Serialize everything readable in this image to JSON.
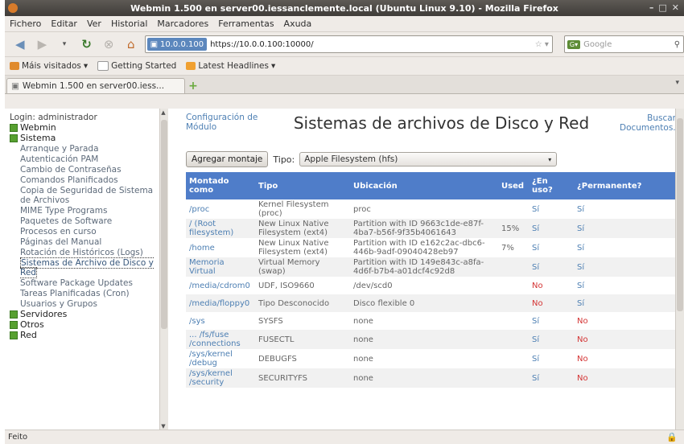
{
  "window": {
    "title": "Webmin 1.500 en server00.iessanclemente.local (Ubuntu Linux 9.10) - Mozilla Firefox"
  },
  "menubar": [
    "Fichero",
    "Editar",
    "Ver",
    "Historial",
    "Marcadores",
    "Ferramentas",
    "Axuda"
  ],
  "nav": {
    "identity": "10.0.0.100",
    "url": "https://10.0.0.100:10000/",
    "search_placeholder": "Google"
  },
  "bookmarks": [
    "Máis visitados",
    "Getting Started",
    "Latest Headlines"
  ],
  "tab": {
    "title": "Webmin 1.500 en server00.iess..."
  },
  "sidebar": {
    "login": "Login: administrador",
    "categories": [
      {
        "label": "Webmin"
      },
      {
        "label": "Sistema"
      },
      {
        "label": "Servidores"
      },
      {
        "label": "Otros"
      },
      {
        "label": "Red"
      }
    ],
    "items": [
      "Arranque y Parada",
      "Autenticación PAM",
      "Cambio de Contraseñas",
      "Comandos Planificados",
      "Copia de Seguridad de Sistema de Archivos",
      "MIME Type Programs",
      "Paquetes de Software",
      "Procesos en curso",
      "Páginas del Manual",
      "Rotación de Históricos (Logs)",
      "Sistemas de Archivo de Disco y Red",
      "Software Package Updates",
      "Tareas Planificadas (Cron)",
      "Usuarios y Grupos"
    ]
  },
  "main": {
    "config_link": "Configuración de Módulo",
    "title": "Sistemas de archivos de Disco y Red",
    "search_link": "Buscar Documentos..",
    "add_button": "Agregar montaje",
    "type_label": "Tipo:",
    "type_value": "Apple Filesystem (hfs)",
    "columns": [
      "Montado como",
      "Tipo",
      "Ubicación",
      "Used",
      "¿En uso?",
      "¿Permanente?"
    ],
    "rows": [
      {
        "mount": "/proc",
        "type": "Kernel Filesystem (proc)",
        "location": "proc",
        "used": "",
        "inuse": "Sí",
        "perm": "Sí"
      },
      {
        "mount": "/ (Root filesystem)",
        "type": "New Linux Native Filesystem (ext4)",
        "location": "Partition with ID 9663c1de-e87f-4ba7-b56f-9f35b4061643",
        "used": "15%",
        "inuse": "Sí",
        "perm": "Sí"
      },
      {
        "mount": "/home",
        "type": "New Linux Native Filesystem (ext4)",
        "location": "Partition with ID e162c2ac-dbc6-446b-9adf-09040428eb97",
        "used": "7%",
        "inuse": "Sí",
        "perm": "Sí"
      },
      {
        "mount": "Memoria Virtual",
        "type": "Virtual Memory (swap)",
        "location": "Partition with ID 149e843c-a8fa-4d6f-b7b4-a01dcf4c92d8",
        "used": "",
        "inuse": "Sí",
        "perm": "Sí"
      },
      {
        "mount": "/media/cdrom0",
        "type": "UDF, ISO9660",
        "location": "/dev/scd0",
        "used": "",
        "inuse": "No",
        "perm": "Sí"
      },
      {
        "mount": "/media/floppy0",
        "type": "Tipo Desconocido",
        "location": "Disco flexible 0",
        "used": "",
        "inuse": "No",
        "perm": "Sí"
      },
      {
        "mount": "/sys",
        "type": "SYSFS",
        "location": "none",
        "used": "",
        "inuse": "Sí",
        "perm": "No"
      },
      {
        "mount": "... /fs/fuse /connections",
        "type": "FUSECTL",
        "location": "none",
        "used": "",
        "inuse": "Sí",
        "perm": "No"
      },
      {
        "mount": "/sys/kernel /debug",
        "type": "DEBUGFS",
        "location": "none",
        "used": "",
        "inuse": "Sí",
        "perm": "No"
      },
      {
        "mount": "/sys/kernel /security",
        "type": "SECURITYFS",
        "location": "none",
        "used": "",
        "inuse": "Sí",
        "perm": "No"
      }
    ]
  },
  "status": {
    "text": "Feito"
  }
}
